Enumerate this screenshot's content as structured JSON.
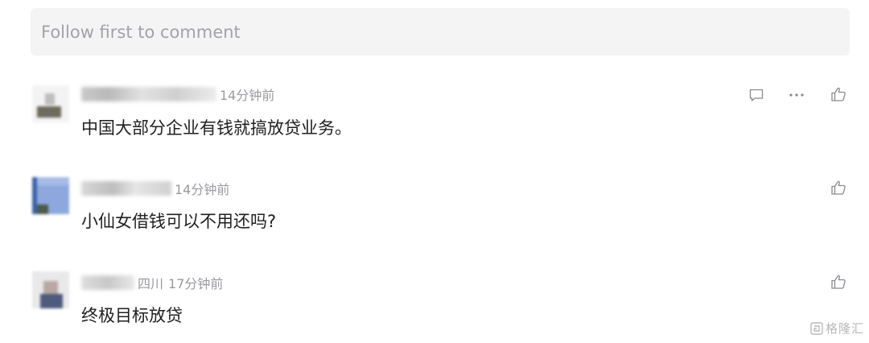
{
  "comment_box": {
    "placeholder": "Follow first to comment"
  },
  "comments": [
    {
      "location": "",
      "time": "14分钟前",
      "text": "中国大部分企业有钱就搞放贷业务。",
      "actions": [
        "reply-icon",
        "more-icon",
        "like-icon"
      ]
    },
    {
      "location": "",
      "time": "14分钟前",
      "text": "小仙女借钱可以不用还吗?",
      "actions": [
        "like-icon"
      ]
    },
    {
      "location": "四川",
      "time": "17分钟前",
      "text": "终极目标放贷",
      "actions": [
        "like-icon"
      ]
    }
  ],
  "watermark": {
    "text": "格隆汇"
  },
  "colors": {
    "input_bg": "#f4f4f5",
    "placeholder": "#a3a3a8",
    "meta_text": "#9a9a9e",
    "body_text": "#1f1f1f",
    "icon": "#8a8a8e"
  }
}
